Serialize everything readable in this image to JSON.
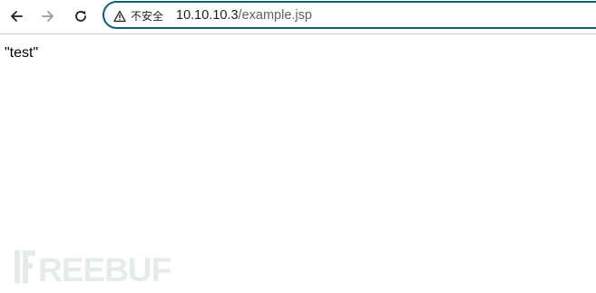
{
  "browser": {
    "security_label": "不安全",
    "url_host": "10.10.10.3",
    "url_path": "/example.jsp",
    "omnibox_border_color": "#0b5f73"
  },
  "icons": {
    "back": "arrow-left-icon",
    "forward": "arrow-right-icon",
    "reload": "reload-icon",
    "security": "warning-triangle-icon"
  },
  "page": {
    "body_text": "\"test\""
  },
  "watermark": {
    "text": "FREEBUF",
    "color": "#e4ece9"
  }
}
